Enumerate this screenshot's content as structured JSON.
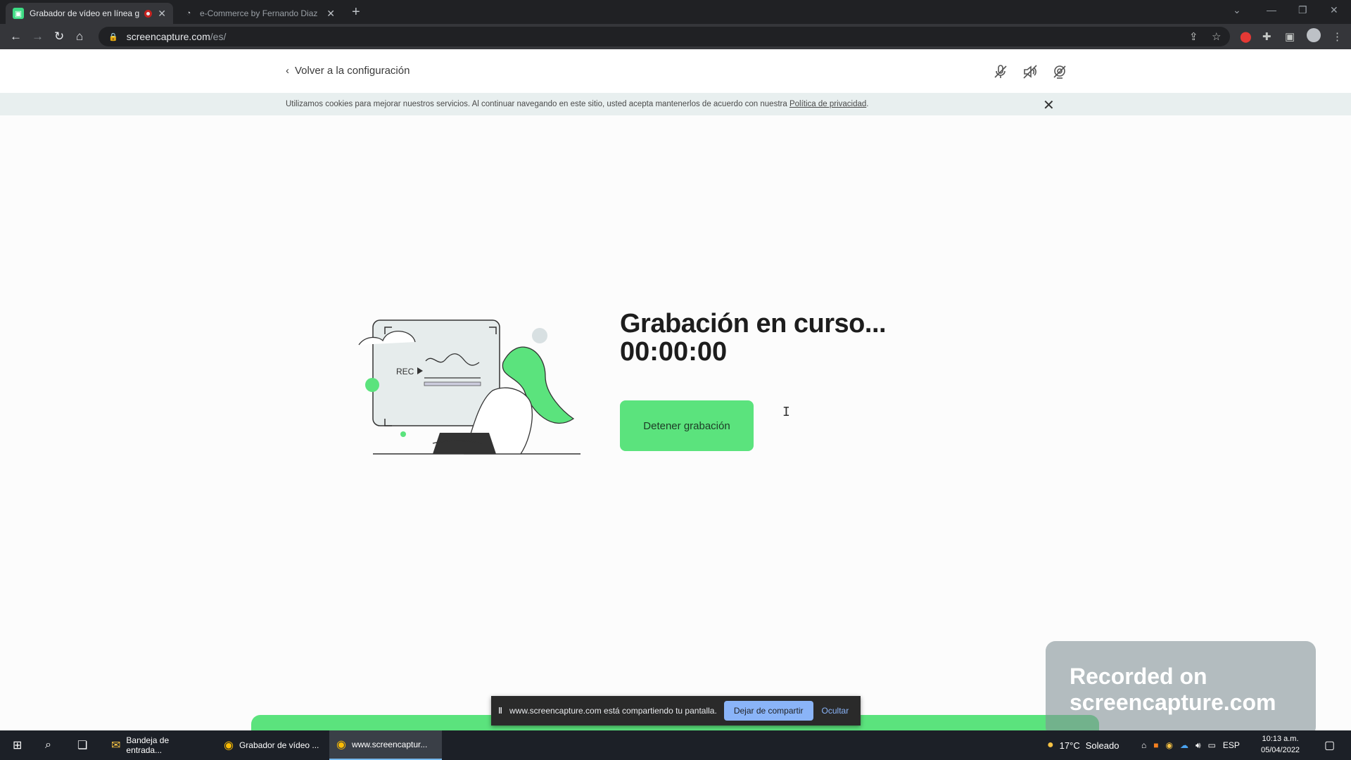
{
  "browser": {
    "tabs": [
      {
        "title": "Grabador de vídeo en línea g",
        "active": true,
        "recording": true
      },
      {
        "title": "e-Commerce by Fernando Diaz",
        "active": false
      }
    ],
    "new_tab_label": "+",
    "address": {
      "domain": "screencapture.com",
      "path": "/es/"
    }
  },
  "header": {
    "back_label": "Volver a la configuración",
    "icons": [
      "mic-off-icon",
      "speaker-off-icon",
      "webcam-off-icon"
    ]
  },
  "cookie_banner": {
    "text": "Utilizamos cookies para mejorar nuestros servicios. Al continuar navegando en este sitio, usted acepta mantenerlos de acuerdo con nuestra ",
    "link": "Política de privacidad",
    "suffix": "."
  },
  "recording": {
    "title": "Grabación en curso...",
    "timer": "00:00:00",
    "stop_label": "Detener grabación",
    "illustration_label": "REC"
  },
  "share_bar": {
    "message": "www.screencapture.com está compartiendo tu pantalla.",
    "stop_label": "Dejar de compartir",
    "hide_label": "Ocultar"
  },
  "watermark": {
    "line1": "Recorded on",
    "line2": "screencapture.com"
  },
  "taskbar": {
    "items": [
      {
        "label": "Bandeja de entrada...",
        "active": false
      },
      {
        "label": "Grabador de vídeo ...",
        "active": false
      },
      {
        "label": "www.screencaptur...",
        "active": true
      }
    ],
    "weather": {
      "temp": "17°C",
      "condition": "Soleado"
    },
    "lang": "ESP",
    "time": "10:13 a.m.",
    "date": "05/04/2022"
  },
  "colors": {
    "accent": "#5be37d",
    "cookie_bg": "#e8efef"
  }
}
